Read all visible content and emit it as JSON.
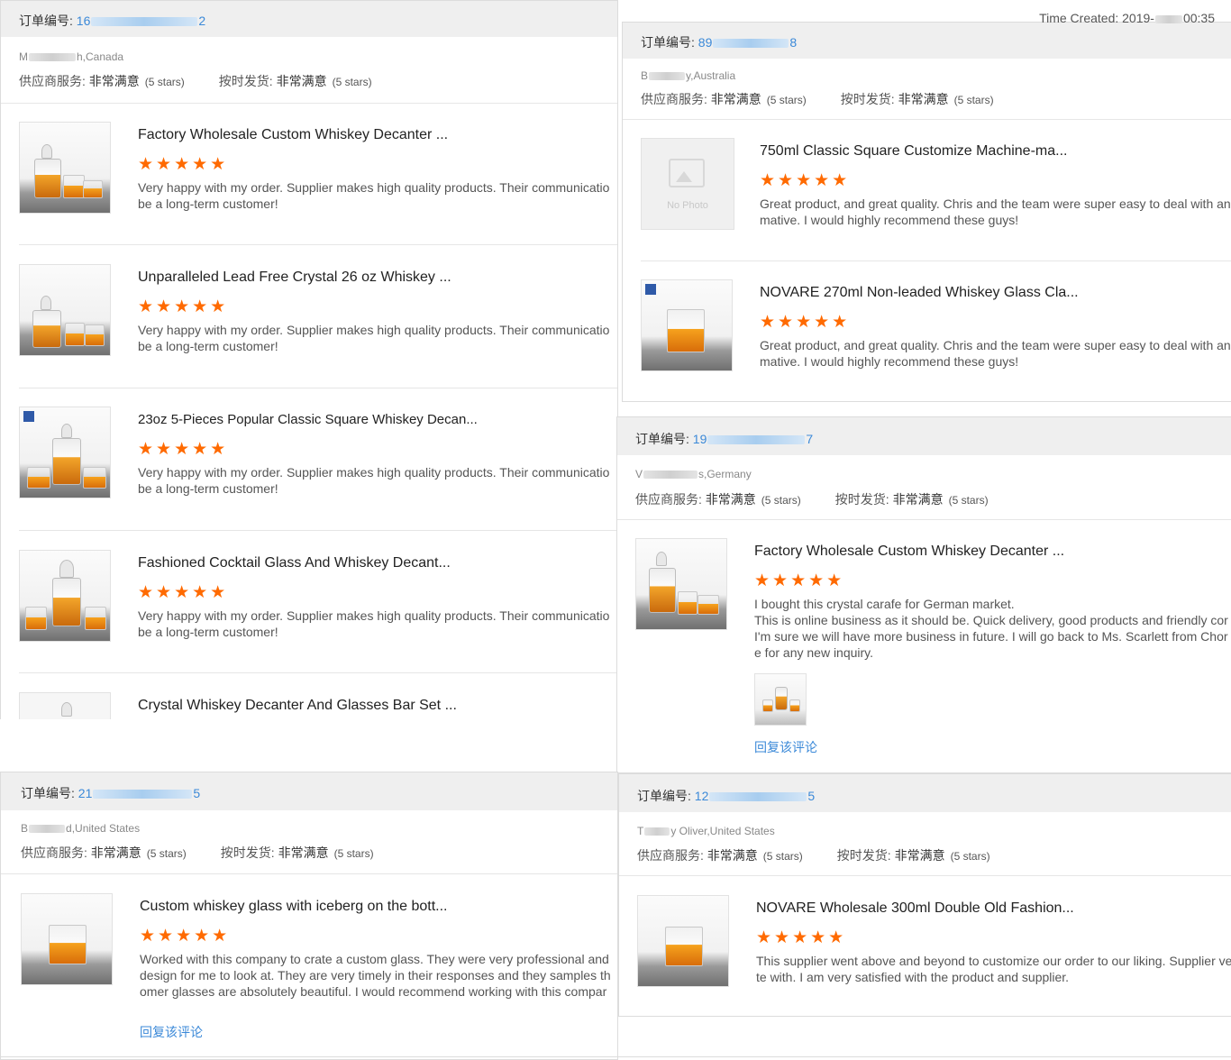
{
  "orders": [
    {
      "order_label": "订单编号:",
      "order_num_start": "16",
      "order_num_end": "2",
      "buyer_start": "M",
      "buyer_end": "h,Canada",
      "supplier_service_label": "供应商服务:",
      "supplier_service_value": "非常满意",
      "supplier_service_stars": "(5 stars)",
      "shipping_label": "按时发货:",
      "shipping_value": "非常满意",
      "shipping_stars": "(5 stars)",
      "items": [
        {
          "title": "Factory Wholesale Custom Whiskey Decanter ...",
          "stars": "★★★★★",
          "review_line1": "Very happy with my order. Supplier makes high quality products. Their communicatio",
          "review_line2": "be a long-term customer!"
        },
        {
          "title": "Unparalleled Lead Free Crystal 26 oz Whiskey ...",
          "stars": "★★★★★",
          "review_line1": "Very happy with my order. Supplier makes high quality products. Their communicatio",
          "review_line2": "be a long-term customer!"
        },
        {
          "title": "23oz 5-Pieces Popular Classic Square Whiskey Decan...",
          "stars": "★★★★★",
          "review_line1": "Very happy with my order. Supplier makes high quality products. Their communicatio",
          "review_line2": "be a long-term customer!"
        },
        {
          "title": "Fashioned Cocktail Glass And Whiskey Decant...",
          "stars": "★★★★★",
          "review_line1": "Very happy with my order. Supplier makes high quality products. Their communicatio",
          "review_line2": "be a long-term customer!"
        },
        {
          "title": "Crystal Whiskey Decanter And Glasses Bar Set ..."
        }
      ]
    },
    {
      "time_created_label": "Time Created: 2019-",
      "time_created_end": "00:35",
      "order_label": "订单编号:",
      "order_num_start": "89",
      "order_num_end": "8",
      "buyer_start": "B",
      "buyer_end": "y,Australia",
      "supplier_service_label": "供应商服务:",
      "supplier_service_value": "非常满意",
      "supplier_service_stars": "(5 stars)",
      "shipping_label": "按时发货:",
      "shipping_value": "非常满意",
      "shipping_stars": "(5 stars)",
      "no_photo": "No Photo",
      "items": [
        {
          "title": "750ml Classic Square Customize Machine-ma...",
          "stars": "★★★★★",
          "review_line1": "Great product, and great quality. Chris and the team were super easy to deal with anc",
          "review_line2": "mative. I would highly recommend these guys!"
        },
        {
          "title": "NOVARE 270ml Non-leaded Whiskey Glass Cla...",
          "stars": "★★★★★",
          "review_line1": "Great product, and great quality. Chris and the team were super easy to deal with anc",
          "review_line2": "mative. I would highly recommend these guys!"
        }
      ]
    },
    {
      "order_label": "订单编号:",
      "order_num_start": "19",
      "order_num_end": "7",
      "buyer_start": "V",
      "buyer_end": "s,Germany",
      "supplier_service_label": "供应商服务:",
      "supplier_service_value": "非常满意",
      "supplier_service_stars": "(5 stars)",
      "shipping_label": "按时发货:",
      "shipping_value": "非常满意",
      "shipping_stars": "(5 stars)",
      "reply": "回复该评论",
      "items": [
        {
          "title": "Factory Wholesale Custom Whiskey Decanter ...",
          "stars": "★★★★★",
          "review_line1": "I bought this crystal carafe for German market.",
          "review_line2": "This is online business as it should be. Quick delivery, good products and friendly cor",
          "review_line3": "I'm sure we will have more business in future. I will go back to Ms. Scarlett from Chor",
          "review_line4": "e for any new inquiry."
        }
      ]
    },
    {
      "order_label": "订单编号:",
      "order_num_start": "21",
      "order_num_end": "5",
      "buyer_start": "B",
      "buyer_end": "d,United States",
      "supplier_service_label": "供应商服务:",
      "supplier_service_value": "非常满意",
      "supplier_service_stars": "(5 stars)",
      "shipping_label": "按时发货:",
      "shipping_value": "非常满意",
      "shipping_stars": "(5 stars)",
      "reply": "回复该评论",
      "items": [
        {
          "title": "Custom whiskey glass with iceberg on the bott...",
          "stars": "★★★★★",
          "review_line1": "Worked with this company to crate a custom glass. They were very professional and",
          "review_line2": "design for me to look at. They are very timely in their responses and they samples th",
          "review_line3": "omer glasses are absolutely beautiful. I would recommend working with this compar"
        }
      ]
    },
    {
      "order_label": "订单编号:",
      "order_num_start": "12",
      "order_num_end": "5",
      "buyer_start": "T",
      "buyer_end": "y Oliver,United States",
      "supplier_service_label": "供应商服务:",
      "supplier_service_value": "非常满意",
      "supplier_service_stars": "(5 stars)",
      "shipping_label": "按时发货:",
      "shipping_value": "非常满意",
      "shipping_stars": "(5 stars)",
      "items": [
        {
          "title": "NOVARE Wholesale 300ml Double Old Fashion...",
          "stars": "★★★★★",
          "review_line1": "This supplier went above and beyond to customize our order to our liking. Supplier ver",
          "review_line2": "te with. I am very satisfied with the product and supplier."
        }
      ]
    }
  ],
  "colors": {
    "star": "#ff6a00",
    "link": "#3b89d8",
    "header_bg": "#efefef"
  }
}
